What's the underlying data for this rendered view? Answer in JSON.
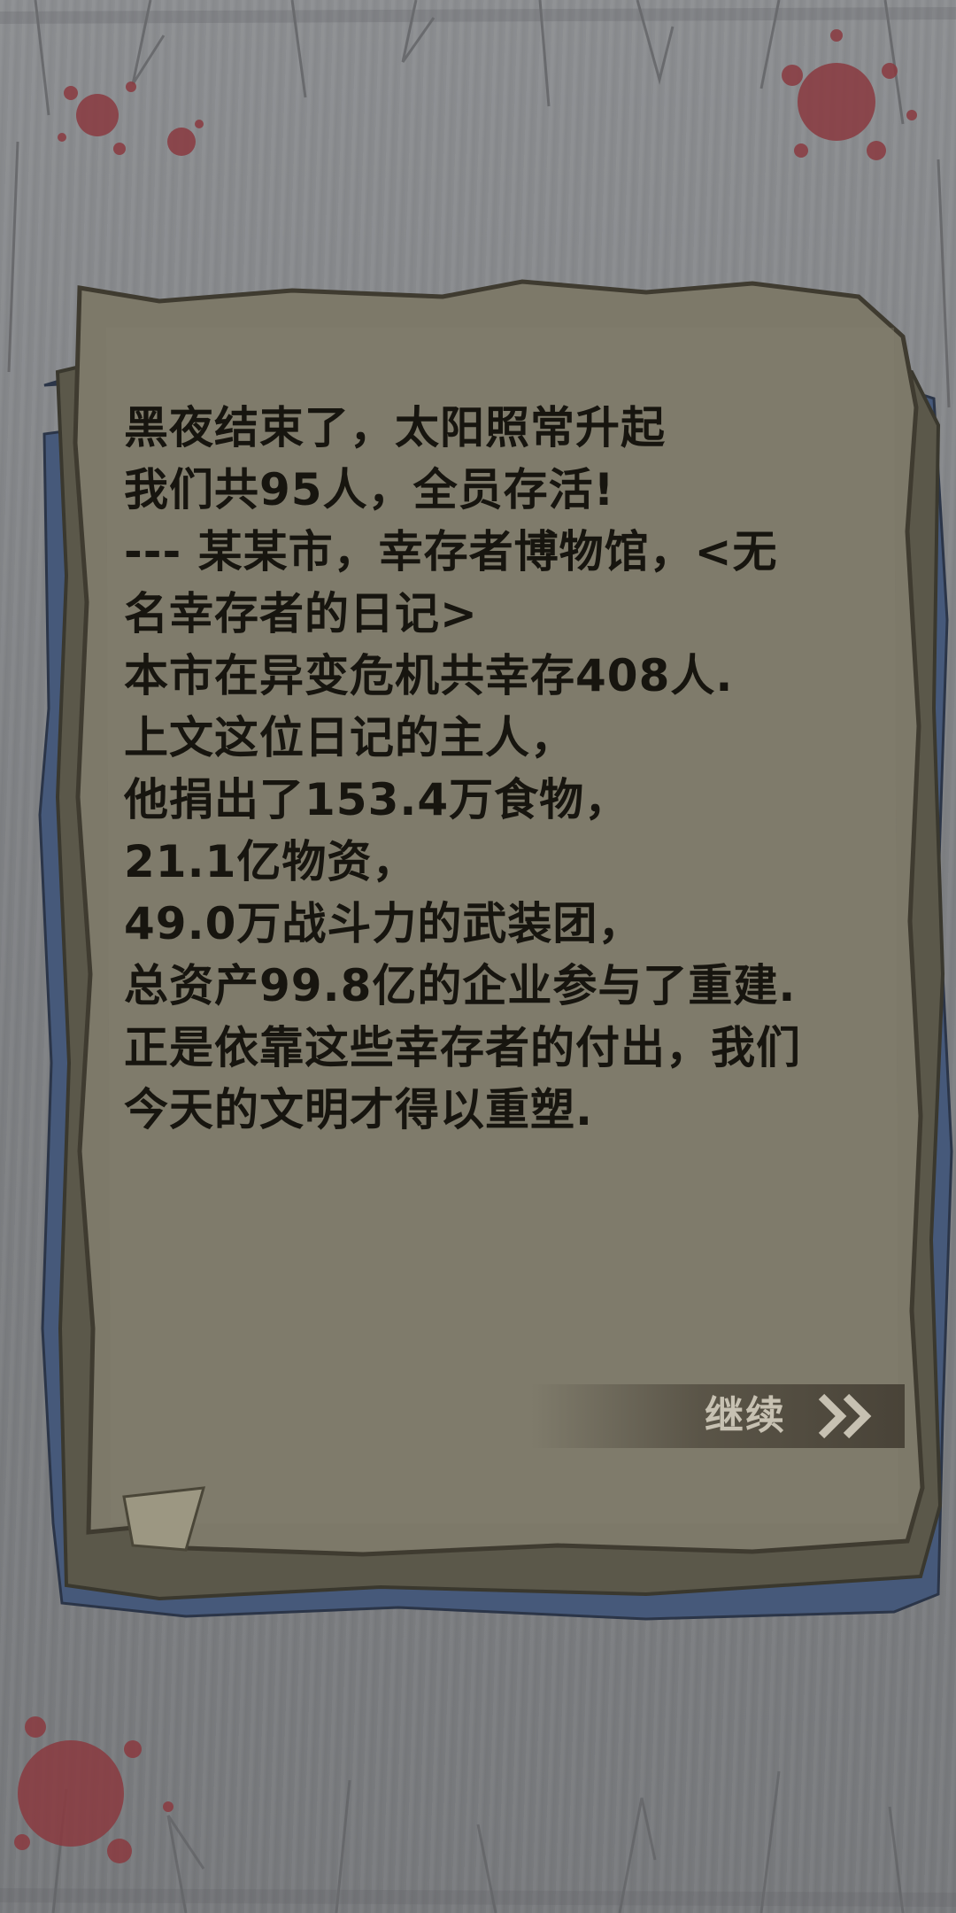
{
  "diary": {
    "lines": [
      "黑夜结束了，太阳照常升起",
      "我们共95人，全员存活!",
      "---  某某市，幸存者博物馆，<无",
      "名幸存者的日记>",
      "本市在异变危机共幸存408人.",
      "上文这位日记的主人，",
      "他捐出了153.4万食物，",
      "21.1亿物资，",
      "49.0万战斗力的武装团，",
      "总资产99.8亿的企业参与了重建.",
      "正是依靠这些幸存者的付出，我们",
      "今天的文明才得以重塑."
    ]
  },
  "continue_button": {
    "label": "继续",
    "icon": "double-chevron-right-icon"
  },
  "colors": {
    "background": "#7b7d80",
    "paper": "#7d7969",
    "paper_edge_blue": "#46597a",
    "text": "#17150f",
    "blood": "#8a3a40",
    "button_text": "#c7c1b2"
  }
}
